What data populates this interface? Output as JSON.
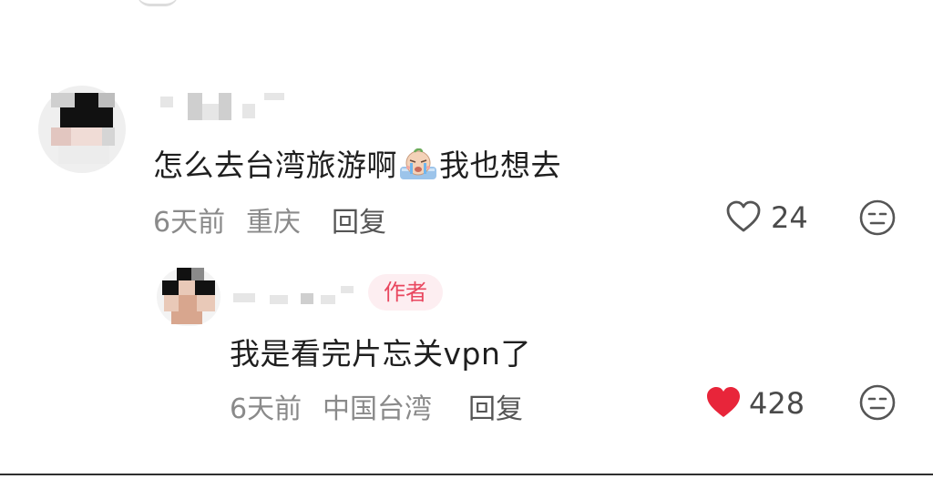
{
  "main_comment": {
    "text_before_emoji": "怎么去台湾旅游啊",
    "text_after_emoji": "我也想去",
    "emoji": "crying-face-emoji",
    "time": "6天前",
    "location": "重庆",
    "reply_label": "回复",
    "likes": "24",
    "liked": false
  },
  "reply_comment": {
    "text": "我是看完片忘关vpn了",
    "author_badge": "作者",
    "time": "6天前",
    "location": "中国台湾",
    "reply_label": "回复",
    "likes": "428",
    "liked": true
  },
  "colors": {
    "liked_heart": "#e8253a",
    "badge_text": "#e9475f",
    "badge_bg": "#fdeef1",
    "meta_text": "#8a8a8a"
  },
  "icons": {
    "like": "heart-outline-icon",
    "liked": "heart-filled-icon",
    "dislike": "unimpressed-face-icon"
  }
}
